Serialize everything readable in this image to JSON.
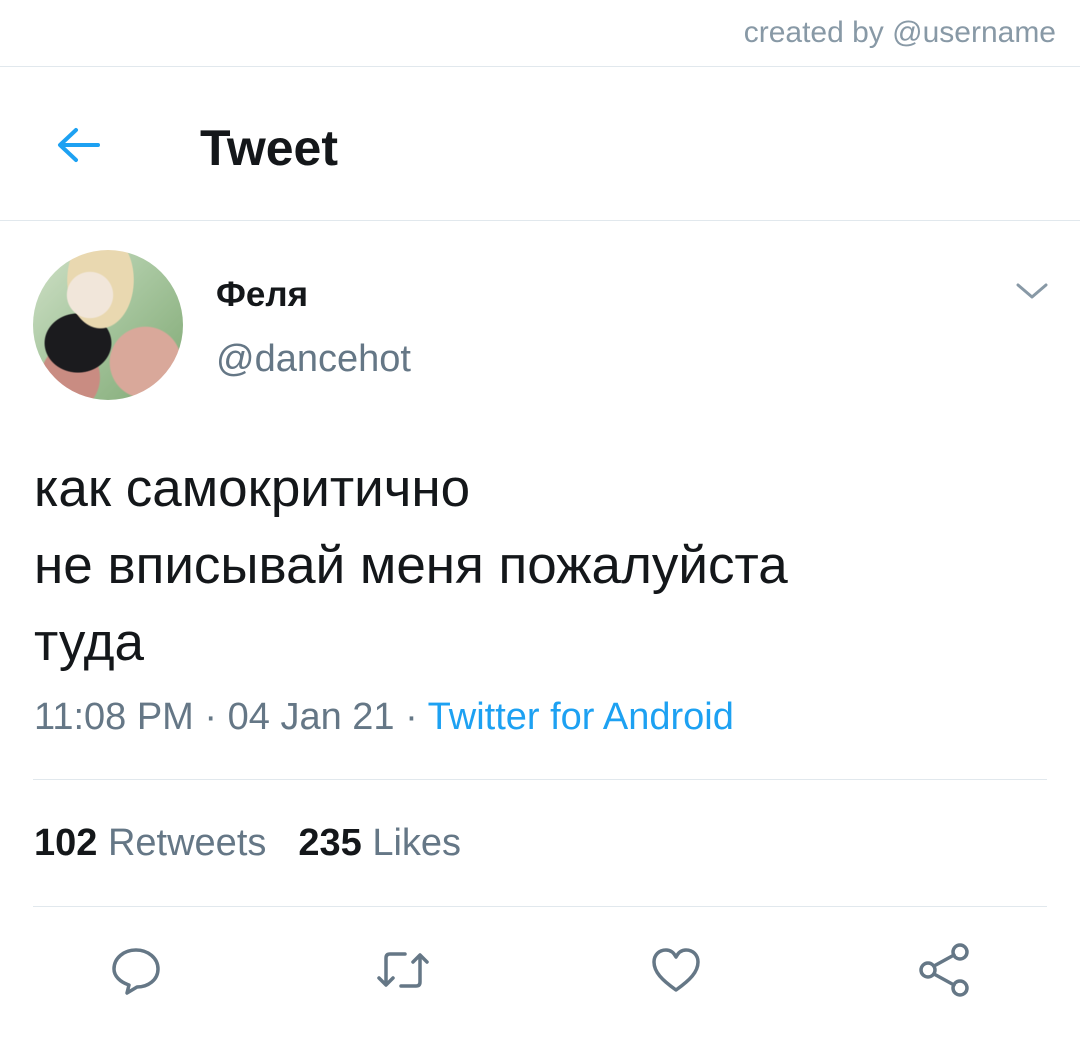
{
  "credit": "created by @username",
  "header": {
    "title": "Tweet",
    "back_icon": "arrow-left-icon",
    "accent_color": "#1da1f2"
  },
  "tweet": {
    "display_name": "Феля",
    "handle": "@dancehot",
    "text_lines": [
      "как самокритично",
      "не вписывай меня пожалуйста",
      "туда"
    ],
    "time": "11:08 PM",
    "date": "04 Jan 21",
    "source": "Twitter for Android",
    "separator": "·"
  },
  "stats": {
    "retweets_count": "102",
    "retweets_label": "Retweets",
    "likes_count": "235",
    "likes_label": "Likes"
  },
  "actions": [
    "reply-icon",
    "retweet-icon",
    "like-icon",
    "share-icon"
  ],
  "colors": {
    "text": "#14171a",
    "secondary": "#657786",
    "link": "#1da1f2",
    "divider": "#e1e8ed"
  }
}
